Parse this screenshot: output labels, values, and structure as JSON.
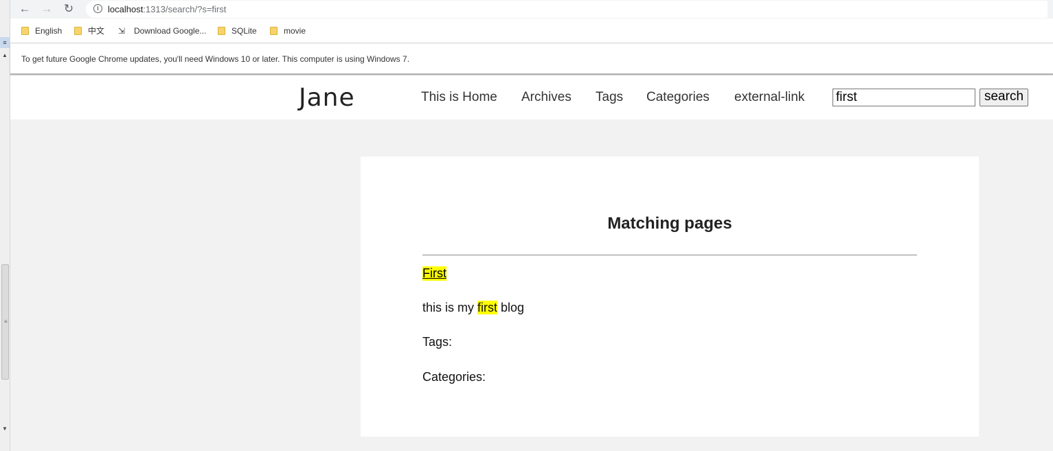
{
  "browser": {
    "url_host": "localhost",
    "url_rest": ":1313/search/?s=first"
  },
  "bookmarks": [
    {
      "label": "English",
      "icon": "folder-icon"
    },
    {
      "label": "中文",
      "icon": "folder-icon"
    },
    {
      "label": "Download Google...",
      "icon": "download-icon"
    },
    {
      "label": "SQLite",
      "icon": "folder-icon"
    },
    {
      "label": "movie",
      "icon": "folder-icon"
    }
  ],
  "infobar": {
    "message": "To get future Google Chrome updates, you'll need Windows 10 or later. This computer is using Windows 7."
  },
  "site": {
    "logo": "Jane",
    "menu": [
      "This is Home",
      "Archives",
      "Tags",
      "Categories",
      "external-link"
    ],
    "search": {
      "value": "first",
      "button_label": "search"
    }
  },
  "results": {
    "heading": "Matching pages",
    "items": [
      {
        "title": "First",
        "summary_before": "this is my ",
        "summary_highlight": "first",
        "summary_after": " blog",
        "tags_label": "Tags:",
        "categories_label": "Categories:"
      }
    ]
  },
  "colors": {
    "highlight": "#ffff00",
    "page_bg": "#f2f2f3"
  }
}
